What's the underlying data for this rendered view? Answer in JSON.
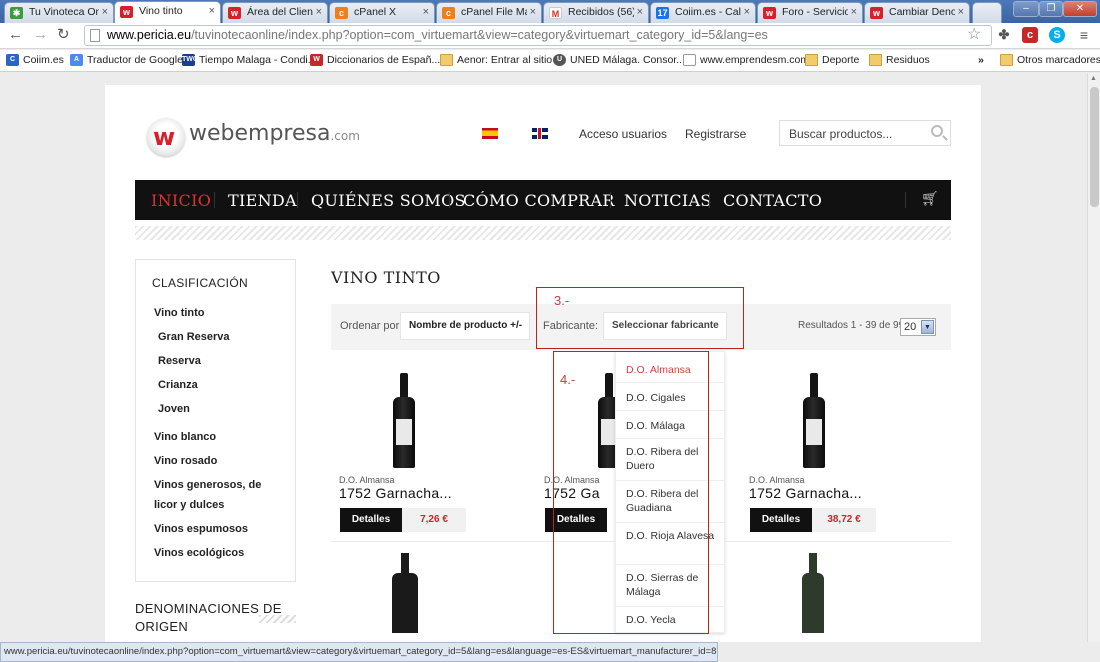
{
  "browser": {
    "tabs": [
      {
        "title": "Tu Vinoteca Onl",
        "icon_color": "#3b9c3b",
        "active": false
      },
      {
        "title": "Vino tinto",
        "icon_color": "#d8202a",
        "active": true
      },
      {
        "title": "Área del Client",
        "icon_color": "#d8202a",
        "active": false
      },
      {
        "title": "cPanel X",
        "icon_color": "#f07e1b",
        "active": false
      },
      {
        "title": "cPanel File Mana",
        "icon_color": "#f07e1b",
        "active": false
      },
      {
        "title": "Recibidos (56) -",
        "icon_color": "#d93025",
        "active": false
      },
      {
        "title": "Coiim.es - Calen",
        "icon_color": "#1a73e8",
        "active": false
      },
      {
        "title": "Foro - Servicio",
        "icon_color": "#d8202a",
        "active": false
      },
      {
        "title": "Cambiar Denom",
        "icon_color": "#d8202a",
        "active": false
      }
    ],
    "url_host": "www.pericia.eu",
    "url_path": "/tuvinotecaonline/index.php?option=com_virtuemart&view=category&virtuemart_category_id=5&lang=es",
    "bookmarks": [
      {
        "label": "Coiim.es",
        "icon": "coiim-icon",
        "icon_color": "#2a66c6"
      },
      {
        "label": "Traductor de Google",
        "icon": "translate-icon",
        "icon_color": "#4a8af4"
      },
      {
        "label": "Tiempo Malaga - Condi...",
        "icon": "twc-icon",
        "icon_color": "#1b3f8b"
      },
      {
        "label": "Diccionarios de Españ...",
        "icon": "wr-icon",
        "icon_color": "#c62828"
      },
      {
        "label": "Aenor: Entrar al sitio",
        "icon": "folder-icon",
        "icon_color": ""
      },
      {
        "label": "UNED Málaga. Consor...",
        "icon": "uned-icon",
        "icon_color": "#555555"
      },
      {
        "label": "www.emprendesm.com",
        "icon": "page-icon",
        "icon_color": ""
      },
      {
        "label": "Deporte",
        "icon": "folder-icon",
        "icon_color": ""
      },
      {
        "label": "Residuos",
        "icon": "folder-icon",
        "icon_color": ""
      }
    ],
    "more_bookmarks": "»",
    "other_bookmarks": "Otros marcadores",
    "status_url": "www.pericia.eu/tuvinotecaonline/index.php?option=com_virtuemart&view=category&virtuemart_category_id=5&lang=es&language=es-ES&virtuemart_manufacturer_id=8"
  },
  "site": {
    "logo_text": "webempresa",
    "logo_suffix": ".com",
    "logo_mark": "w",
    "login_link": "Acceso usuarios",
    "register_link": "Registrarse",
    "search_placeholder": "Buscar productos...",
    "menu": [
      "INICIO",
      "TIENDA",
      "QUIÉNES SOMOS",
      "CÓMO COMPRAR",
      "NOTICIAS",
      "CONTACTO"
    ],
    "accent_color": "#e03030"
  },
  "sidebar": {
    "title": "CLASIFICACIÓN",
    "items": [
      "Vino tinto",
      "Gran Reserva",
      "Reserva",
      "Crianza",
      "Joven",
      "Vino blanco",
      "Vino rosado",
      "Vinos generosos, de",
      "licor y dulces",
      "Vinos espumosos",
      "Vinos ecológicos"
    ],
    "denominaciones_title": "DENOMINACIONES DE ORIGEN"
  },
  "main": {
    "title": "VINO TINTO",
    "order_label": "Ordenar por",
    "order_value": "Nombre de producto +/-",
    "manufacturer_label": "Fabricante:",
    "manufacturer_value": "Seleccionar fabricante",
    "results_text": "Resultados 1 - 39 de 99",
    "per_page": "20",
    "products": [
      {
        "category": "D.O. Almansa",
        "name": "1752 Garnacha...",
        "button": "Detalles",
        "price": "7,26 €"
      },
      {
        "category": "D.O. Almansa",
        "name": "1752 Ga",
        "button": "Detalles",
        "price": ""
      },
      {
        "category": "D.O. Almansa",
        "name": "1752 Garnacha...",
        "button": "Detalles",
        "price": "38,72 €"
      }
    ]
  },
  "annotations": {
    "box3": "3.-",
    "box4": "4.-"
  },
  "manufacturer_dropdown": [
    "D.O. Almansa",
    "D.O. Cigales",
    "D.O. Málaga",
    "D.O. Ribera del Duero",
    "D.O. Ribera del Guadiana",
    "D.O. Rioja Alavesa",
    "D.O. Sierras de Málaga",
    "D.O. Yecla"
  ]
}
